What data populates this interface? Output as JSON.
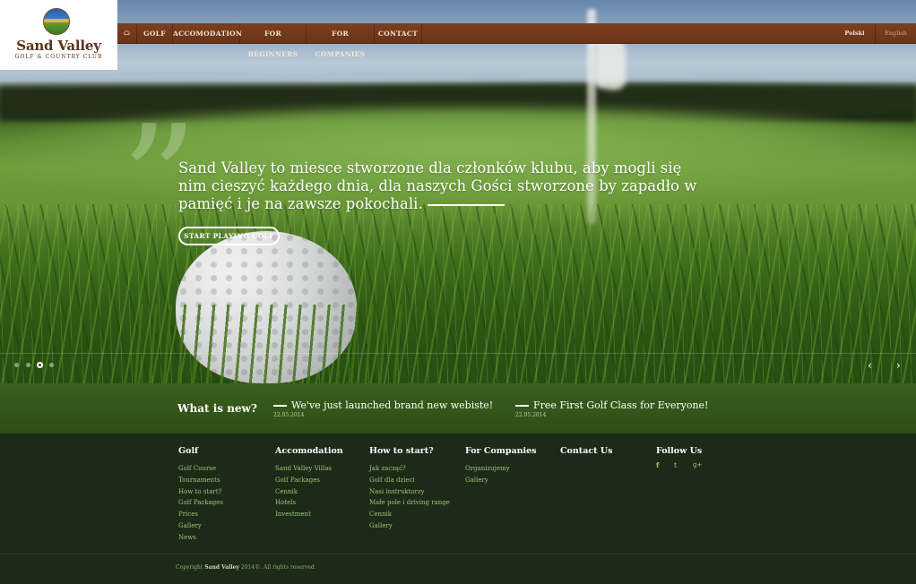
{
  "logo": {
    "name": "Sand Valley",
    "subtitle": "Golf & Country Club"
  },
  "nav": {
    "home_icon": "home-icon",
    "items": [
      {
        "label": "Golf"
      },
      {
        "label": "Accomodation"
      },
      {
        "label": "For Beginners"
      },
      {
        "label": "For Companies"
      },
      {
        "label": "Contact"
      }
    ],
    "languages": [
      {
        "label": "Polski"
      },
      {
        "label": "English"
      }
    ]
  },
  "hero": {
    "quote_mark": "”",
    "text": "Sand Valley to miesce stworzone dla członków klubu, aby mogli się nim cieszyć każdego dnia, dla naszych Gości stworzone by zapadło w pamięć i je na zawsze pokochali.",
    "button_label": "Start playing golf",
    "prev_arrow": "‹",
    "next_arrow": "›",
    "slides_count": 4,
    "active_slide": 3
  },
  "news": {
    "title": "What is new?",
    "items": [
      {
        "headline": "We've just launched brand new webiste!",
        "date": "22.05.2014"
      },
      {
        "headline": "Free First Golf Class for Everyone!",
        "date": "22.05.2014"
      }
    ]
  },
  "footer": {
    "columns": [
      {
        "title": "Golf",
        "links": [
          "Golf Course",
          "Tournaments",
          "How to start?",
          "Golf Packages",
          "Prices",
          "Gallery",
          "News"
        ]
      },
      {
        "title": "Accomodation",
        "links": [
          "Sand Valley Villas",
          "Golf Packages",
          "Cennik",
          "Hotels",
          "Investment"
        ]
      },
      {
        "title": "How to start?",
        "links": [
          "Jak zacząć?",
          "Golf dla dzieci",
          "Nasi instruktorzy",
          "Małe pole i driving range",
          "Cennik",
          "Gallery"
        ]
      },
      {
        "title": "For Companies",
        "links": [
          "Organizujemy",
          "Gallery"
        ]
      },
      {
        "title": "Contact Us",
        "links": []
      },
      {
        "title": "Follow Us",
        "links": []
      }
    ],
    "social": [
      {
        "icon": "facebook-icon",
        "glyph": "f"
      },
      {
        "icon": "twitter-icon",
        "glyph": "t"
      },
      {
        "icon": "google-plus-icon",
        "glyph": "g+"
      }
    ],
    "copyright_prefix": "Copyright",
    "copyright_brand": "Sand Valley",
    "copyright_suffix": "2014©. All rights reserved."
  },
  "colors": {
    "nav_bg": "#6e3719",
    "footer_bg": "#1c2a17",
    "link": "#9fc27b",
    "news_bg": "#34561a"
  }
}
